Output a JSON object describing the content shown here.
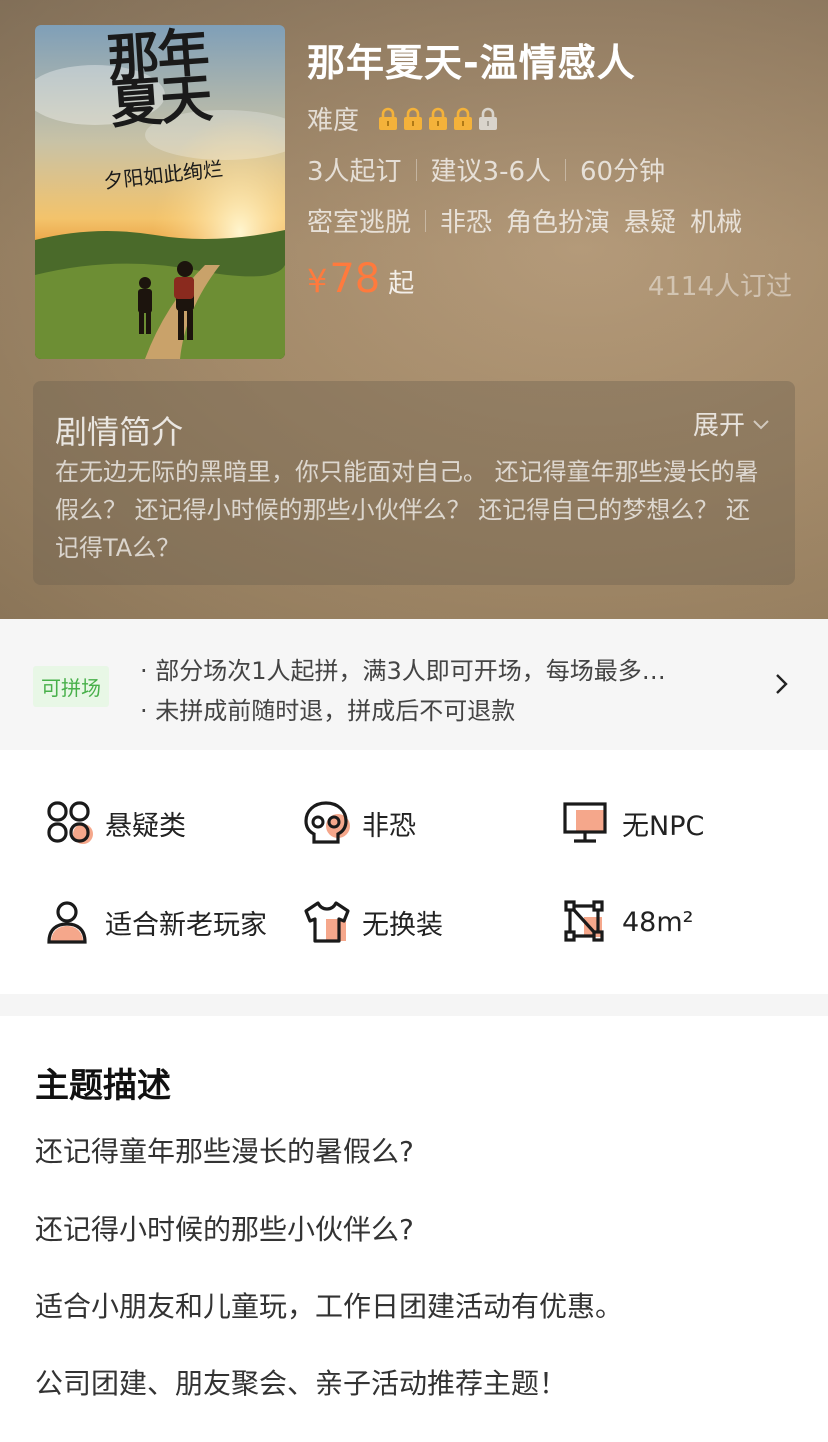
{
  "game": {
    "title": "那年夏天-温情感人",
    "difficulty_label": "难度",
    "difficulty_level": 4,
    "difficulty_max": 5,
    "min_players": "3人起订",
    "suggested_players": "建议3-6人",
    "duration": "60分钟",
    "tags": [
      "密室逃脱",
      "非恐",
      "角色扮演",
      "悬疑",
      "机械"
    ],
    "price_symbol": "¥",
    "price_value": "78",
    "price_suffix": "起",
    "booked_count": "4114人订过"
  },
  "poster": {
    "title_text": "那年夏天",
    "subtitle_text": "夕阳如此绚烂"
  },
  "synopsis": {
    "title": "剧情简介",
    "expand_label": "展开",
    "text": "在无边无际的黑暗里，你只能面对自己。 还记得童年那些漫长的暑假么？ 还记得小时候的那些小伙伴么？ 还记得自己的梦想么？ 还记得TA么？"
  },
  "combine": {
    "badge": "可拼场",
    "line1": "· 部分场次1人起拼，满3人即可开场，每场最多…",
    "line2": "· 未拼成前随时退，拼成后不可退款"
  },
  "features": [
    {
      "label": "悬疑类",
      "icon": "puzzle-grid-icon"
    },
    {
      "label": "非恐",
      "icon": "skull-icon"
    },
    {
      "label": "无NPC",
      "icon": "monitor-icon"
    },
    {
      "label": "适合新老玩家",
      "icon": "person-icon"
    },
    {
      "label": "无换装",
      "icon": "tshirt-icon"
    },
    {
      "label": "48m²",
      "icon": "area-icon"
    }
  ],
  "description": {
    "title": "主题描述",
    "lines": [
      "还记得童年那些漫长的暑假么?",
      "还记得小时候的那些小伙伴么?",
      "适合小朋友和儿童玩，工作日团建活动有优惠。",
      "公司团建、朋友聚会、亲子活动推荐主题！"
    ]
  },
  "colors": {
    "accent_orange": "#ff7a3d",
    "combine_green": "#48b04a",
    "icon_orange": "#f28a64"
  }
}
